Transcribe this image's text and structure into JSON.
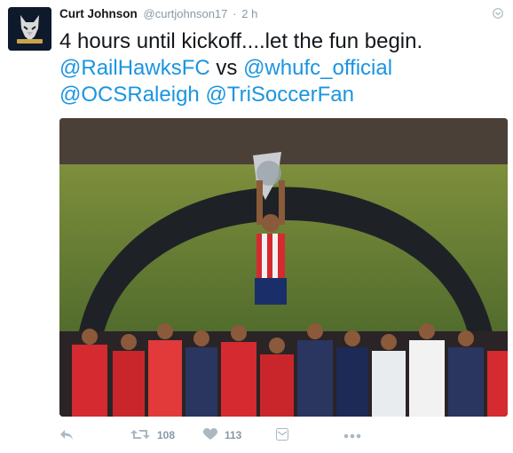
{
  "tweet": {
    "author_name": "Curt Johnson",
    "handle": "@curtjohnson17",
    "separator": "·",
    "time": "2 h",
    "line1": "4 hours until kickoff....let the fun begin.",
    "mentions": [
      "@RailHawksFC",
      "@whufc_official",
      "@OCSRaleigh",
      "@TriSoccerFan"
    ],
    "mention_joiner": " vs ",
    "retweet_count": "108",
    "like_count": "113"
  },
  "icons": {
    "avatar": "railhawks-logo",
    "caret": "chevron-down-icon",
    "reply": "reply-icon",
    "retweet": "retweet-icon",
    "like": "heart-icon",
    "dm": "message-icon",
    "more": "more-dots-icon"
  },
  "colors": {
    "link": "#1b95e0",
    "muted": "#8899a6",
    "icon": "#aab8c2"
  }
}
